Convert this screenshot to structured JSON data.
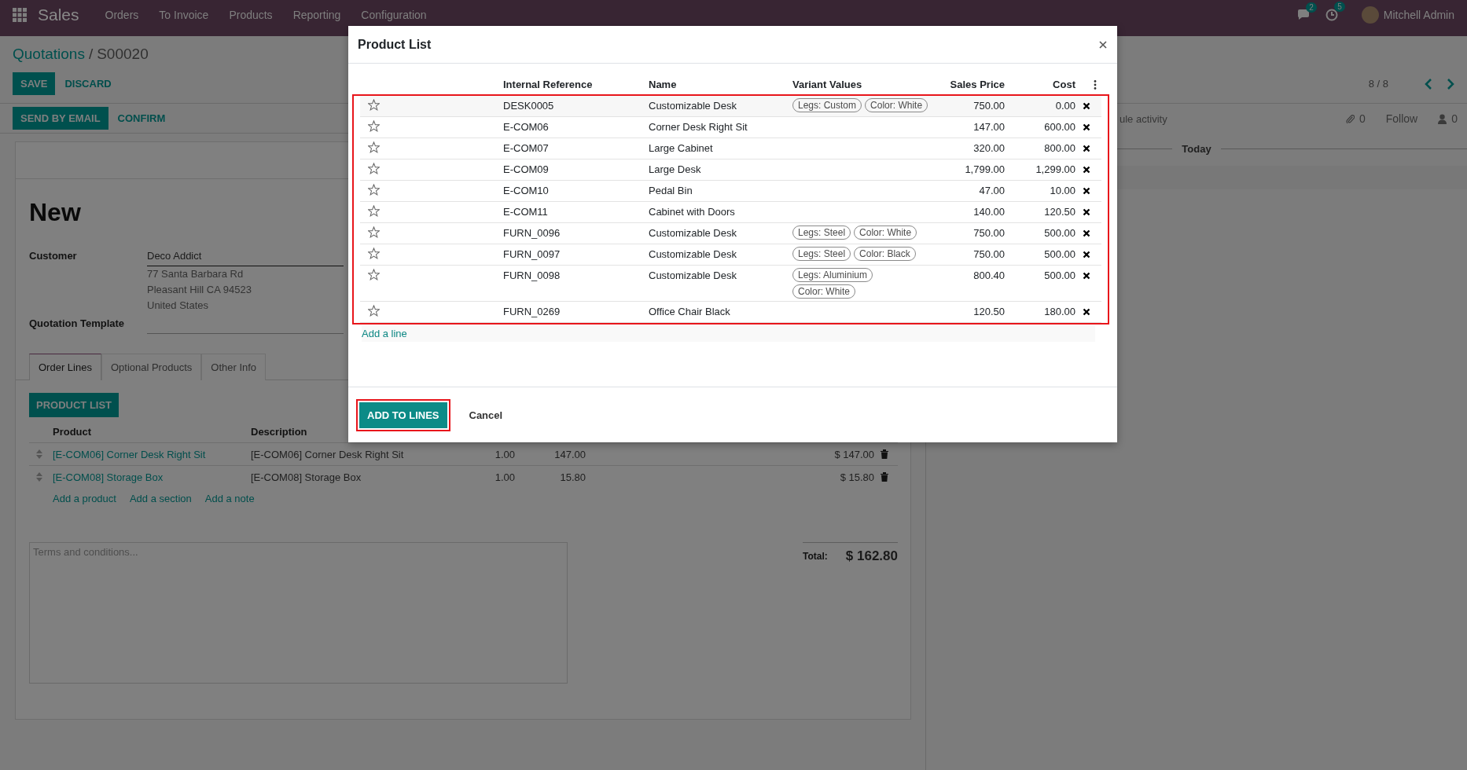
{
  "navbar": {
    "app": "Sales",
    "menus": [
      "Orders",
      "To Invoice",
      "Products",
      "Reporting",
      "Configuration"
    ],
    "messages_badge": "2",
    "activities_badge": "5",
    "user": "Mitchell Admin"
  },
  "breadcrumb": {
    "parent": "Quotations",
    "separator": "/",
    "current": "S00020"
  },
  "form_buttons": [
    {
      "label": "SAVE",
      "primary": true
    },
    {
      "label": "DISCARD",
      "primary": false
    }
  ],
  "pager": "8 / 8",
  "status_buttons": [
    {
      "label": "SEND BY EMAIL",
      "primary": true
    },
    {
      "label": "CONFIRM",
      "primary": false
    }
  ],
  "form": {
    "title": "New",
    "fields": [
      {
        "label": "Customer",
        "value": "Deco Addict",
        "address": [
          "77 Santa Barbara Rd",
          "Pleasant Hill CA 94523",
          "United States"
        ]
      },
      {
        "label": "Quotation Template"
      }
    ],
    "tabs": [
      {
        "label": "Order Lines",
        "selected": true
      },
      {
        "label": "Optional Products",
        "selected": false
      },
      {
        "label": "Other Info",
        "selected": false
      }
    ],
    "product_list_button": "PRODUCT LIST",
    "order_lines": {
      "columns": [
        "Product",
        "Description"
      ],
      "rows": [
        {
          "product": "[E-COM06] Corner Desk Right Sit",
          "description": "[E-COM06] Corner Desk Right Sit",
          "quantity": "1.00",
          "unit_price": "147.00",
          "subtotal": "$ 147.00"
        },
        {
          "product": "[E-COM08] Storage Box",
          "description": "[E-COM08] Storage Box",
          "quantity": "1.00",
          "unit_price": "15.80",
          "subtotal": "$ 15.80"
        }
      ],
      "add_links": [
        "Add a product",
        "Add a section",
        "Add a note"
      ]
    },
    "terms": {
      "placeholder": "Terms and conditions..."
    },
    "total": {
      "label": "Total:",
      "value": "$ 162.80"
    }
  },
  "chatter": {
    "schedule": "ule activity",
    "attachments": "0",
    "follow": "Follow",
    "followers": "0",
    "separator": "Today"
  },
  "dialog": {
    "title": "Product List",
    "columns": [
      "Internal Reference",
      "Name",
      "Variant Values",
      "Sales Price",
      "Cost"
    ],
    "rows_highlighted": true,
    "rows": [
      {
        "favorite": false,
        "reference": "DESK0005",
        "name": "Customizable Desk",
        "variants": [
          "Legs: Custom",
          "Color: White"
        ],
        "price": "750.00",
        "cost": "0.00"
      },
      {
        "favorite": false,
        "reference": "E-COM06",
        "name": "Corner Desk Right Sit",
        "price": "147.00",
        "cost": "600.00"
      },
      {
        "favorite": false,
        "reference": "E-COM07",
        "name": "Large Cabinet",
        "price": "320.00",
        "cost": "800.00"
      },
      {
        "favorite": false,
        "reference": "E-COM09",
        "name": "Large Desk",
        "price": "1,799.00",
        "cost": "1,299.00"
      },
      {
        "favorite": false,
        "reference": "E-COM10",
        "name": "Pedal Bin",
        "price": "47.00",
        "cost": "10.00"
      },
      {
        "favorite": false,
        "reference": "E-COM11",
        "name": "Cabinet with Doors",
        "price": "140.00",
        "cost": "120.50"
      },
      {
        "favorite": false,
        "reference": "FURN_0096",
        "name": "Customizable Desk",
        "variants": [
          "Legs: Steel",
          "Color: White"
        ],
        "price": "750.00",
        "cost": "500.00"
      },
      {
        "favorite": false,
        "reference": "FURN_0097",
        "name": "Customizable Desk",
        "variants": [
          "Legs: Steel",
          "Color: Black"
        ],
        "price": "750.00",
        "cost": "500.00"
      },
      {
        "favorite": false,
        "reference": "FURN_0098",
        "name": "Customizable Desk",
        "variants": [
          "Legs: Aluminium",
          "Color: White"
        ],
        "price": "800.40",
        "cost": "500.00"
      },
      {
        "favorite": false,
        "reference": "FURN_0269",
        "name": "Office Chair Black",
        "price": "120.50",
        "cost": "180.00"
      }
    ],
    "add_line": "Add a line",
    "buttons": [
      {
        "label": "ADD TO LINES",
        "primary": true,
        "highlighted": true
      },
      {
        "label": "Cancel",
        "primary": false,
        "highlighted": false
      }
    ]
  }
}
